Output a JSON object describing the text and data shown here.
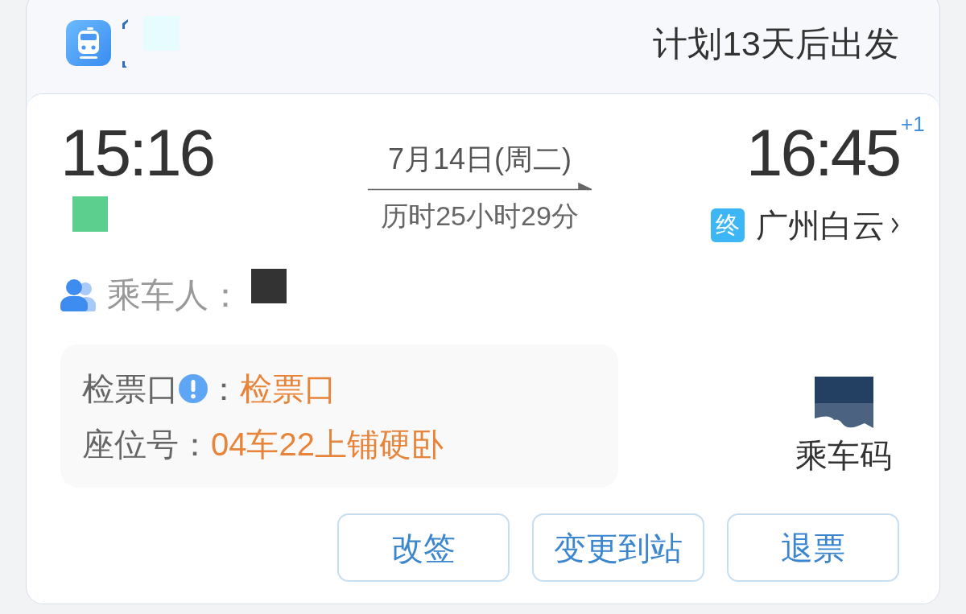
{
  "header": {
    "schedule_note": "计划13天后出发"
  },
  "trip": {
    "departure_time": "15:16",
    "date": "7月14日(周二)",
    "duration": "历时25小时29分",
    "arrival_time": "16:45",
    "day_offset": "+1",
    "arrival_badge": "终",
    "arrival_station": "广州白云"
  },
  "passenger": {
    "label": "乘车人："
  },
  "details": [
    {
      "label": "检票口",
      "info": true,
      "separator": "：",
      "value": "检票口"
    },
    {
      "label": "座位号",
      "info": false,
      "separator": "：",
      "value": "04车22上铺硬卧"
    }
  ],
  "boarding_code": {
    "label": "乘车码"
  },
  "actions": [
    {
      "label": "改签"
    },
    {
      "label": "变更到站"
    },
    {
      "label": "退票"
    }
  ]
}
